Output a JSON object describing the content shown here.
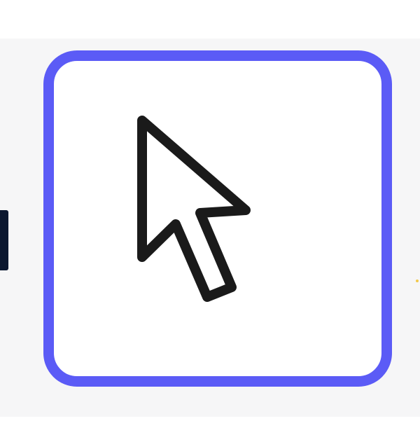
{
  "toolbar": {
    "active_tool": {
      "icon": "cursor-arrow-icon",
      "state": "selected",
      "accent_color": "#5b5bf6"
    },
    "colors": {
      "background": "#f6f6f7",
      "tile": "#ffffff",
      "icon_stroke": "#1a1a1a",
      "left_fragment": "#0c1830",
      "right_fragment": "#f2c94c"
    }
  }
}
